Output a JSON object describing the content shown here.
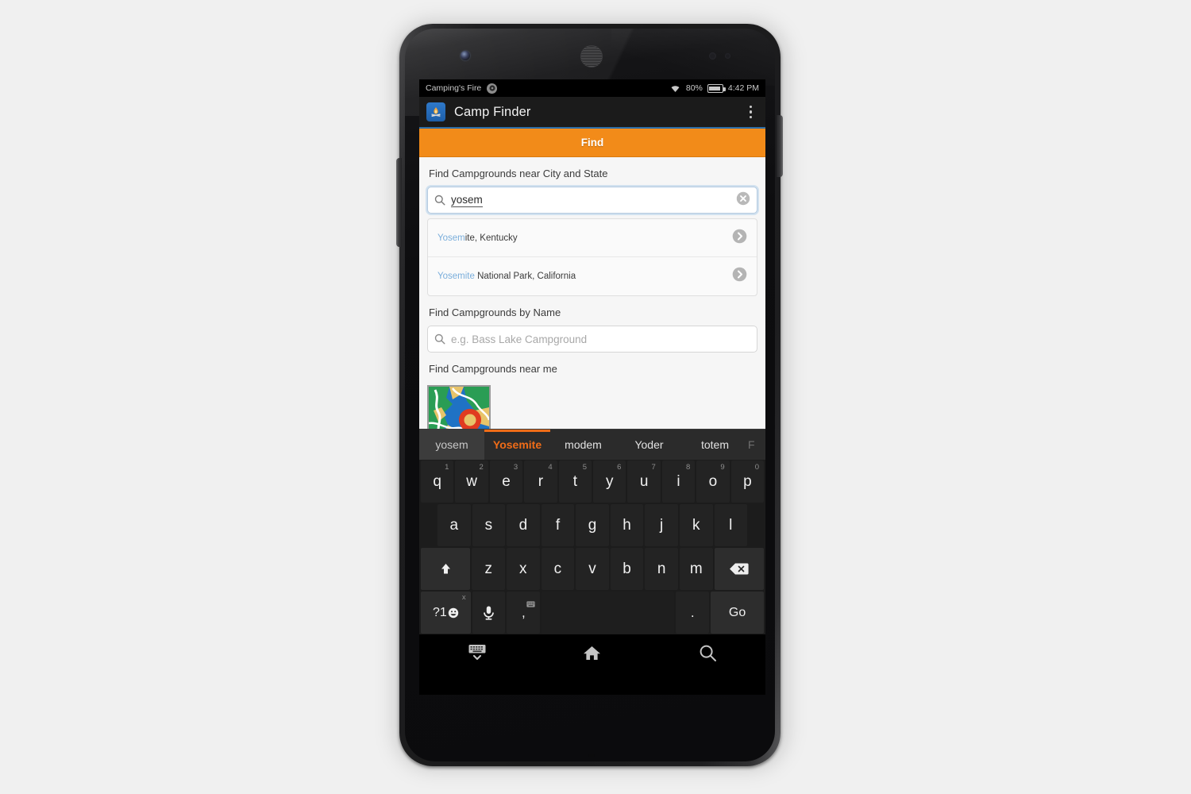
{
  "status_bar": {
    "app_notification": "Camping's Fire",
    "notification_badge": "",
    "battery_percent": "80%",
    "time": "4:42 PM",
    "wifi_icon": "wifi-icon",
    "battery_icon": "battery-icon"
  },
  "action_bar": {
    "app_icon": "campfire-app-icon",
    "title": "Camp Finder",
    "overflow_icon": "overflow-menu-icon"
  },
  "tab": {
    "label": "Find"
  },
  "form": {
    "city_state_label": "Find Campgrounds near City and State",
    "city_state_value": "yosem",
    "search_icon": "search-icon",
    "clear_icon": "clear-circle-icon",
    "suggestions": [
      {
        "match": "Yosem",
        "rest": "ite, Kentucky",
        "chevron": "chevron-right-icon"
      },
      {
        "match": "Yosemite",
        "rest": " National Park, California",
        "chevron": "chevron-right-icon"
      }
    ],
    "name_label": "Find Campgrounds by Name",
    "name_placeholder": "e.g. Bass Lake Campground",
    "near_me_label": "Find Campgrounds near me",
    "near_me_icon": "map-location-pin-thumbnail"
  },
  "keyboard": {
    "suggestion_bar": [
      {
        "text": "yosem",
        "style": "typed"
      },
      {
        "text": "Yosemite",
        "style": "best"
      },
      {
        "text": "modem",
        "style": "normal"
      },
      {
        "text": "Yoder",
        "style": "normal"
      },
      {
        "text": "totem",
        "style": "normal"
      },
      {
        "text": "F",
        "style": "cut"
      }
    ],
    "row1": [
      {
        "key": "q",
        "num": "1"
      },
      {
        "key": "w",
        "num": "2"
      },
      {
        "key": "e",
        "num": "3"
      },
      {
        "key": "r",
        "num": "4"
      },
      {
        "key": "t",
        "num": "5"
      },
      {
        "key": "y",
        "num": "6"
      },
      {
        "key": "u",
        "num": "7"
      },
      {
        "key": "i",
        "num": "8"
      },
      {
        "key": "o",
        "num": "9"
      },
      {
        "key": "p",
        "num": "0"
      }
    ],
    "row2": [
      "a",
      "s",
      "d",
      "f",
      "g",
      "h",
      "j",
      "k",
      "l"
    ],
    "row3": {
      "shift_icon": "shift-arrow-icon",
      "keys": [
        "z",
        "x",
        "c",
        "v",
        "b",
        "n",
        "m"
      ],
      "backspace_icon": "backspace-icon"
    },
    "row4": {
      "symbols_label": "?1",
      "emoji_icon": "emoji-smiley-icon",
      "cut_sup": "x",
      "mic_icon": "microphone-icon",
      "comma_label": ",",
      "comma_sup_icon": "keyboard-switch-icon",
      "space_label": "",
      "period_label": ".",
      "go_label": "Go"
    }
  },
  "nav_bar": {
    "back_icon": "hide-keyboard-icon",
    "home_icon": "home-icon",
    "search_icon": "search-nav-icon"
  },
  "colors": {
    "accent_orange": "#f28b19",
    "suggestion_orange": "#ef6c18",
    "link_blue": "#7aaedb",
    "actionbar_underline": "#2d6ea8"
  }
}
